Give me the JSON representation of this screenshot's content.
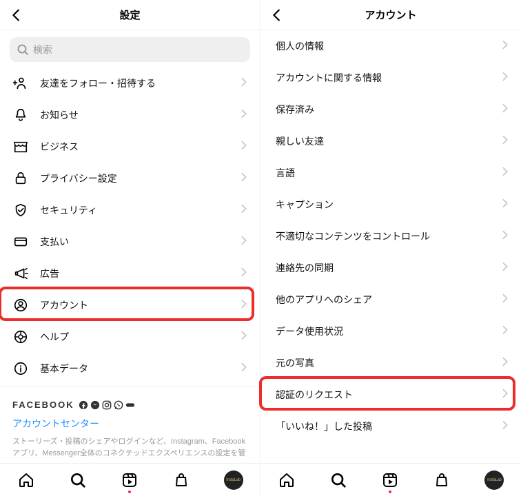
{
  "left": {
    "title": "設定",
    "search_placeholder": "検索",
    "items": [
      {
        "icon": "user-plus",
        "label": "友達をフォロー・招待する"
      },
      {
        "icon": "bell",
        "label": "お知らせ"
      },
      {
        "icon": "shop",
        "label": "ビジネス"
      },
      {
        "icon": "lock",
        "label": "プライバシー設定"
      },
      {
        "icon": "shield",
        "label": "セキュリティ"
      },
      {
        "icon": "card",
        "label": "支払い"
      },
      {
        "icon": "megaphone",
        "label": "広告"
      },
      {
        "icon": "account",
        "label": "アカウント"
      },
      {
        "icon": "help",
        "label": "ヘルプ"
      },
      {
        "icon": "info",
        "label": "基本データ"
      }
    ],
    "fb_brand": "FACEBOOK",
    "fb_link": "アカウントセンター",
    "fb_desc": "ストーリーズ・投稿のシェアやログインなど、Instagram、Facebookアプリ、Messenger全体のコネクテッドエクスペリエンスの設定を管"
  },
  "right": {
    "title": "アカウント",
    "items": [
      {
        "label": "個人の情報"
      },
      {
        "label": "アカウントに関する情報"
      },
      {
        "label": "保存済み"
      },
      {
        "label": "親しい友達"
      },
      {
        "label": "言語"
      },
      {
        "label": "キャプション"
      },
      {
        "label": "不適切なコンテンツをコントロール"
      },
      {
        "label": "連絡先の同期"
      },
      {
        "label": "他のアプリへのシェア"
      },
      {
        "label": "データ使用状況"
      },
      {
        "label": "元の写真"
      },
      {
        "label": "認証のリクエスト"
      },
      {
        "label": "「いいね！」した投稿"
      }
    ]
  },
  "highlights": {
    "left_account": true,
    "right_verify": true
  }
}
